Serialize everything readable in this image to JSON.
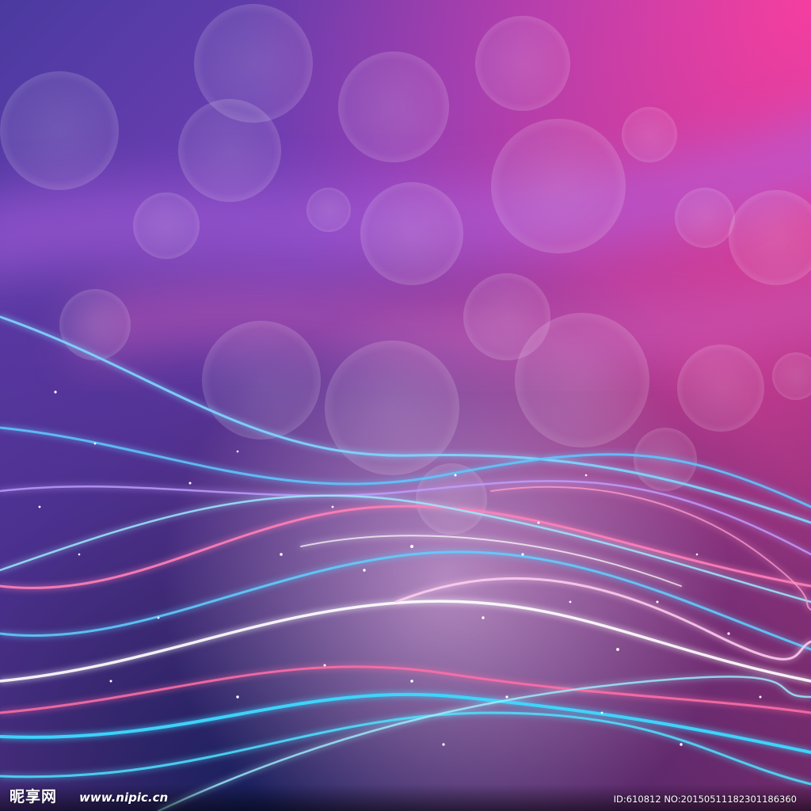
{
  "watermark": {
    "logo_text": "昵享网",
    "site_url": "www.nipic.cn",
    "image_id_text": "ID:610812 NO:20150511182301186360"
  },
  "colors": {
    "top_right_magenta": "#e8358e",
    "upper_purple": "#7a3fb8",
    "mid_violet": "#5a2f9a",
    "deep_navy": "#1f2a6a",
    "cyan_glow": "#3fd8ff",
    "pink_glow": "#ff5fa8",
    "white_glow": "#ffffff"
  },
  "artwork": {
    "subject": "abstract glowing wave lines over bokeh gradient background",
    "icon": "wave-lines-graphic"
  }
}
